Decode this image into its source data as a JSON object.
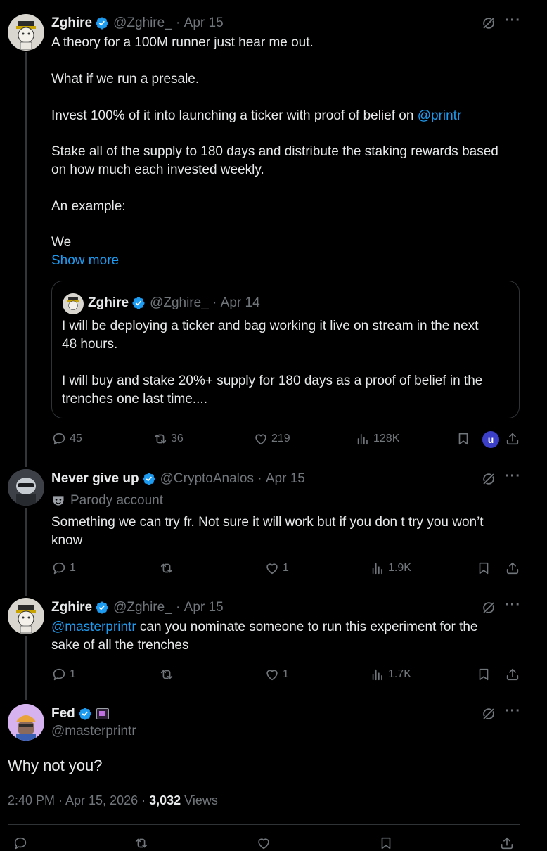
{
  "tweet1": {
    "name": "Zghire",
    "handle": "@Zghire_",
    "date": "Apr 15",
    "lines": [
      "A theory for a 100M runner just hear me out.",
      "What if we run a presale.",
      "Invest 100% of it into launching a ticker with proof of belief on",
      "@printr",
      "Stake all of the supply to 180 days and distribute the staking rewards based",
      "on how much each invested weekly.",
      "An example:",
      "We"
    ],
    "show_more": "Show more",
    "quote": {
      "name": "Zghire",
      "handle": "@Zghire_",
      "date": "Apr 14",
      "lines": [
        "I will be deploying a ticker and bag working it live on stream in the next",
        "48 hours.",
        "I will buy and stake 20%+ supply for 180 days as a proof of belief in the",
        "trenches one last time...."
      ]
    },
    "replies": "45",
    "reposts": "36",
    "likes": "219",
    "views": "128K",
    "user_badge": "u"
  },
  "tweet2": {
    "name": "Never give up",
    "handle": "@CryptoAnalos",
    "date": "Apr 15",
    "parody": "Parody account",
    "lines": [
      "Something we can try fr. Not sure it will work but if you don t try you won’t",
      "know"
    ],
    "replies": "1",
    "likes": "1",
    "views": "1.9K"
  },
  "tweet3": {
    "name": "Zghire",
    "handle": "@Zghire_",
    "date": "Apr 15",
    "mention": "@masterprintr",
    "line1_rest": " can you nominate someone to run this experiment for the",
    "line2": "sake of all the trenches",
    "replies": "1",
    "likes": "1",
    "views": "1.7K"
  },
  "main": {
    "name": "Fed",
    "handle": "@masterprintr",
    "text": "Why not you?",
    "timestamp": "2:40 PM · Apr 15, 2026 · ",
    "views_count": "3,032",
    "views_label": " Views"
  },
  "colors": {
    "background": "#000000",
    "text": "#e7e9ea",
    "muted": "#71767b",
    "link": "#1d9bf0",
    "verified": "#1d9bf0",
    "divider": "#2f3336"
  },
  "icons": [
    "verified-badge-icon",
    "grok-icon",
    "more-icon",
    "reply-icon",
    "repost-icon",
    "like-icon",
    "views-icon",
    "bookmark-icon",
    "share-icon",
    "parody-mask-icon"
  ]
}
